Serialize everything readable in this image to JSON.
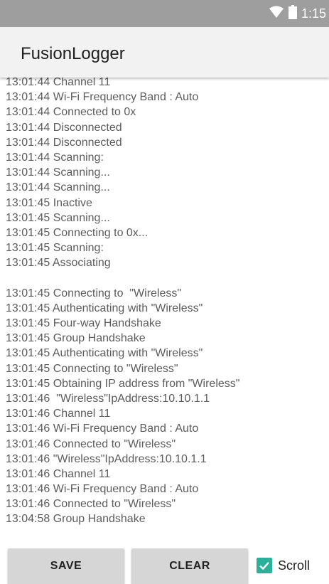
{
  "status_bar": {
    "time": "1:15",
    "icons": [
      "wifi-icon",
      "battery-icon"
    ]
  },
  "app_bar": {
    "title": "FusionLogger"
  },
  "log": {
    "lines": [
      "13:01:44 Channel 11",
      "13:01:44 Wi-Fi Frequency Band : Auto",
      "13:01:44 Connected to 0x",
      "13:01:44 Disconnected",
      "13:01:44 Disconnected",
      "13:01:44 Scanning:",
      "13:01:44 Scanning...",
      "13:01:44 Scanning...",
      "13:01:45 Inactive",
      "13:01:45 Scanning...",
      "13:01:45 Connecting to 0x...",
      "13:01:45 Scanning:",
      "13:01:45 Associating",
      "",
      "13:01:45 Connecting to  \"Wireless\"",
      "13:01:45 Authenticating with \"Wireless\"",
      "13:01:45 Four-way Handshake",
      "13:01:45 Group Handshake",
      "13:01:45 Authenticating with \"Wireless\"",
      "13:01:45 Connecting to \"Wireless\"",
      "13:01:45 Obtaining IP address from \"Wireless\"",
      "13:01:46  \"Wireless\"IpAddress:10.10.1.1",
      "13:01:46 Channel 11",
      "13:01:46 Wi-Fi Frequency Band : Auto",
      "13:01:46 Connected to \"Wireless\"",
      "13:01:46 \"Wireless\"IpAddress:10.10.1.1",
      "13:01:46 Channel 11",
      "13:01:46 Wi-Fi Frequency Band : Auto",
      "13:01:46 Connected to \"Wireless\"",
      "13:04:58 Group Handshake"
    ]
  },
  "bottom_bar": {
    "save_label": "SAVE",
    "clear_label": "CLEAR",
    "scroll_label": "Scroll",
    "scroll_checked": true
  },
  "colors": {
    "status_bar": "#9e9e9e",
    "app_bar": "#f2f2f2",
    "log_text": "#5c5c5c",
    "button": "#d6d6d6",
    "accent": "#2bb19a"
  }
}
